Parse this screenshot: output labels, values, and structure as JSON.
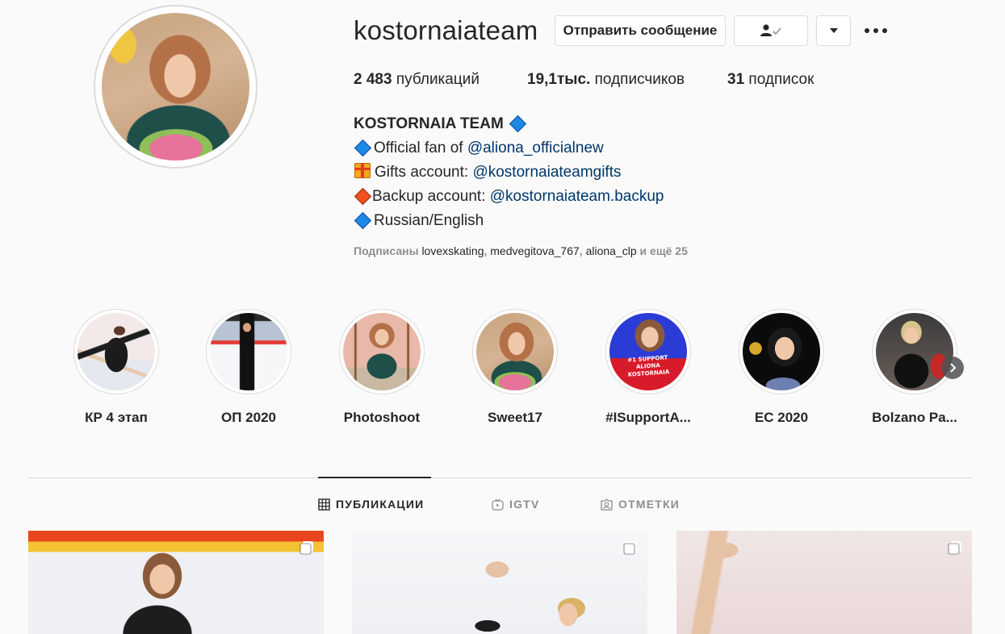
{
  "profile": {
    "username": "kostornaiateam",
    "message_button": "Отправить сообщение",
    "stats": {
      "posts_count": "2 483",
      "posts_label": "публикаций",
      "followers_count": "19,1тыс.",
      "followers_label": "подписчиков",
      "following_count": "31",
      "following_label": "подписок"
    },
    "bio": {
      "name": "KOSTORNAIA TEAM",
      "line1_prefix": "Official fan of ",
      "line1_link": "@aliona_officialnew",
      "line2_prefix": "Gifts account: ",
      "line2_link": "@kostornaiateamgifts",
      "line3_prefix": "Backup account: ",
      "line3_link": "@kostornaiateam.backup",
      "line4": "Russian/English"
    },
    "followed_by": {
      "prefix": "Подписаны ",
      "user1": "lovexskating",
      "sep1": ", ",
      "user2": "medvegitova_767",
      "sep2": ", ",
      "user3": "aliona_clp",
      "suffix": " и ещё 25"
    }
  },
  "highlights": [
    {
      "label": "КР 4 этап"
    },
    {
      "label": "ОП 2020"
    },
    {
      "label": "Photoshoot"
    },
    {
      "label": "Sweet17"
    },
    {
      "label": "#ISupportA..."
    },
    {
      "label": "ЕС 2020"
    },
    {
      "label": "Bolzano Pa..."
    }
  ],
  "highlight_text": {
    "support_line1": "#1 SUPPORT",
    "support_line2": "ALIONA",
    "support_line3": "KOSTORNAIA"
  },
  "tabs": [
    {
      "label": "ПУБЛИКАЦИИ",
      "icon": "grid-icon",
      "active": true
    },
    {
      "label": "IGTV",
      "icon": "igtv-icon",
      "active": false
    },
    {
      "label": "ОТМЕТКИ",
      "icon": "tagged-icon",
      "active": false
    }
  ],
  "colors": {
    "link": "#00376b",
    "text": "#262626",
    "muted": "#8e8e8e",
    "border": "#dbdbdb",
    "background": "#fafafa"
  }
}
